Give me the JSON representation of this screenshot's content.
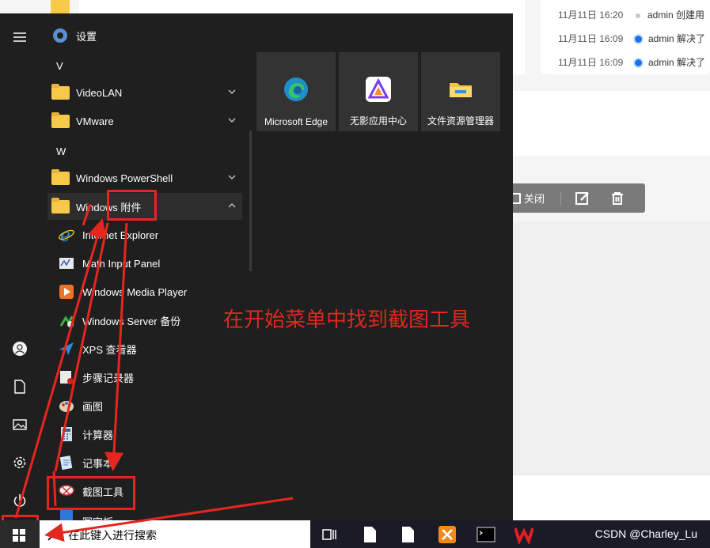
{
  "background": {
    "timeline": [
      {
        "time": "11月11日 16:20",
        "text": "admin 创建用",
        "dot": "grey"
      },
      {
        "time": "11月11日 16:09",
        "text": "admin 解决了",
        "dot": "blue"
      },
      {
        "time": "11月11日 16:09",
        "text": "admin 解决了",
        "dot": "blue"
      }
    ],
    "toolbar": {
      "close_label": "关闭",
      "edit_icon": "edit-icon",
      "delete_icon": "trash-icon"
    }
  },
  "start_menu": {
    "settings_label": "设置",
    "letters": {
      "v": "V",
      "w": "W"
    },
    "groups": {
      "videolan": "VideoLAN",
      "vmware": "VMware",
      "powershell": "Windows PowerShell",
      "accessories": "Windows 附件"
    },
    "apps": {
      "ie": "Internet Explorer",
      "math": "Math Input Panel",
      "wmp": "Windows Media Player",
      "wsb": "Windows Server 备份",
      "xps": "XPS 查看器",
      "steps": "步骤记录器",
      "paint": "画图",
      "calc": "计算器",
      "notepad": "记事本",
      "snip": "截图工具",
      "wordpad": "写字板"
    },
    "tiles": {
      "edge": "Microsoft Edge",
      "wuying": "无影应用中心",
      "explorer": "文件资源管理器"
    }
  },
  "annotation": "在开始菜单中找到截图工具",
  "taskbar": {
    "search_placeholder": "在此键入进行搜索",
    "watermark": "CSDN @Charley_Lu"
  },
  "colors": {
    "accent_red": "#e5261f",
    "menu_bg": "#1f1f1f",
    "tile_bg": "#333333"
  }
}
